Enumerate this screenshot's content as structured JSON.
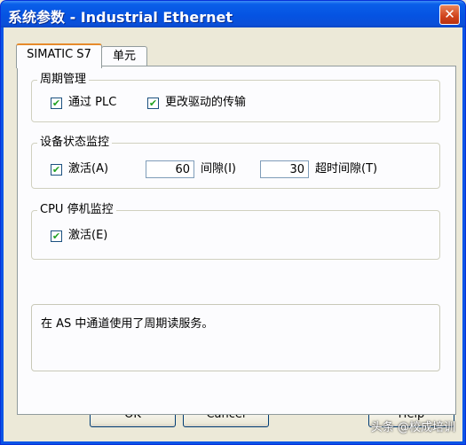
{
  "window": {
    "title": "系统参数 - Industrial Ethernet",
    "close_glyph": "✕"
  },
  "tabs": [
    {
      "label": "SIMATIC S7"
    },
    {
      "label": "单元"
    }
  ],
  "cycle_group": {
    "legend": "周期管理",
    "via_plc": {
      "label": "通过 PLC",
      "checked": true
    },
    "change_driver": {
      "label": "更改驱动的传输",
      "checked": true
    }
  },
  "device_group": {
    "legend": "设备状态监控",
    "activate": {
      "label": "激活(A)",
      "checked": true
    },
    "interval_value": "60",
    "interval_label": "间隙(I)",
    "timeout_value": "30",
    "timeout_label": "超时间隙(T)"
  },
  "cpu_group": {
    "legend": "CPU 停机监控",
    "activate": {
      "label": "激活(E)",
      "checked": true
    }
  },
  "info_text": "在 AS 中通道使用了周期读服务。",
  "buttons": {
    "ok": "OK",
    "cancel": "Cancel",
    "help": "Help"
  },
  "watermark": "头条 @校成培训",
  "check_glyph": "✔"
}
